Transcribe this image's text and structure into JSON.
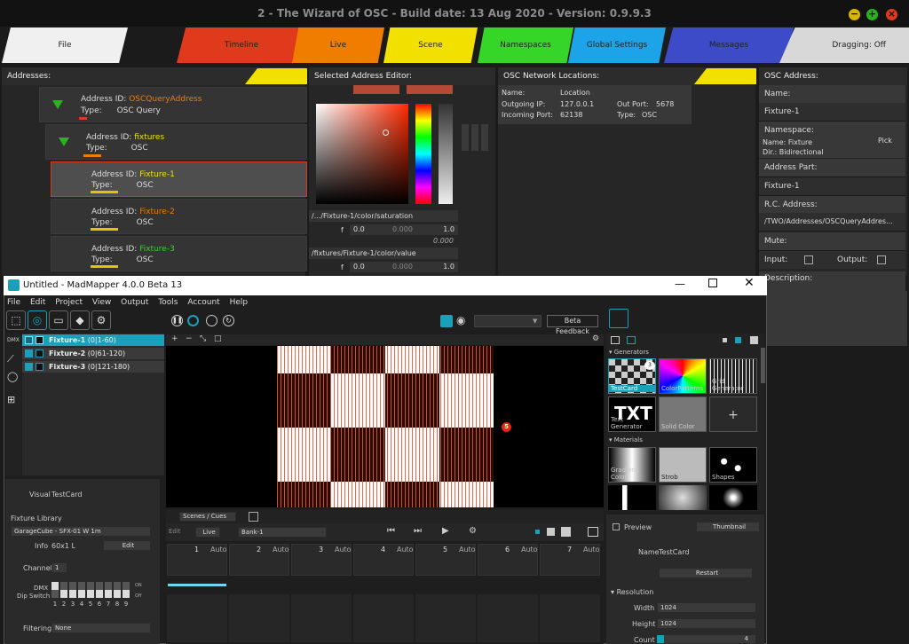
{
  "window_title": "2 - The Wizard of OSC - Build date: 13 Aug 2020 - Version: 0.9.9.3",
  "tabs": [
    {
      "label": "File",
      "color": "#f0f0f0"
    },
    {
      "label": "Timeline",
      "color": "#e03a1c"
    },
    {
      "label": "Live",
      "color": "#f07c00"
    },
    {
      "label": "Scene",
      "color": "#f2e100"
    },
    {
      "label": "Namespaces",
      "color": "#35d628"
    },
    {
      "label": "Global Settings",
      "color": "#1ca3e8"
    },
    {
      "label": "Messages",
      "color": "#3d4bc9"
    },
    {
      "label": "Dragging: Off",
      "color": "#d8d8d8"
    }
  ],
  "panels": {
    "addresses": "Addresses:",
    "selected_editor": "Selected Address Editor:",
    "osc_network": "OSC Network Locations:",
    "osc_address": "OSC Address:"
  },
  "addresses": [
    {
      "id_label": "Address ID:",
      "id": "OSCQueryAddress",
      "type_label": "Type:",
      "type": "OSC Query",
      "id_color": "#f07c00"
    },
    {
      "id_label": "Address ID:",
      "id": "fixtures",
      "type_label": "Type:",
      "type": "OSC",
      "id_color": "#f2e100"
    },
    {
      "id_label": "Address ID:",
      "id": "Fixture-1",
      "type_label": "Type:",
      "type": "OSC",
      "id_color": "#f2e100"
    },
    {
      "id_label": "Address ID:",
      "id": "Fixture-2",
      "type_label": "Type:",
      "type": "OSC",
      "id_color": "#f07c00"
    },
    {
      "id_label": "Address ID:",
      "id": "Fixture-3",
      "type_label": "Type:",
      "type": "OSC",
      "id_color": "#35d628"
    }
  ],
  "editor": {
    "sat_path": "/.../Fixture-1/color/saturation",
    "sat_f": "f",
    "sat_min": "0.0",
    "sat_mid": "0.000",
    "sat_max": "1.0",
    "sat_val": "0.000",
    "val_path": "/fixtures/Fixture-1/color/value",
    "val_f": "f",
    "val_min": "0.0",
    "val_mid": "0.000",
    "val_max": "1.0"
  },
  "network": {
    "name_label": "Name:",
    "name": "Location",
    "out_ip_label": "Outgoing IP:",
    "out_ip": "127.0.0.1",
    "out_port_label": "Out Port:",
    "out_port": "5678",
    "in_port_label": "Incoming Port:",
    "in_port": "62138",
    "type_label": "Type:",
    "type": "OSC"
  },
  "osc_address": {
    "name_label": "Name:",
    "name": "Fixture-1",
    "namespace_label": "Namespace:",
    "ns_name": "Name: Fixture",
    "ns_dir": "Dir.:    Bidirectional",
    "pick": "Pick",
    "address_part_label": "Address Part:",
    "address_part": "Fixture-1",
    "rc_label": "R.C. Address:",
    "rc": "/TWO/Addresses/OSCQueryAddres...",
    "mute_label": "Mute:",
    "input_label": "Input:",
    "output_label": "Output:",
    "description_label": "Description:"
  },
  "mm": {
    "title": "Untitled - MadMapper 4.0.0 Beta 13",
    "menu": [
      "File",
      "Edit",
      "Project",
      "View",
      "Output",
      "Tools",
      "Account",
      "Help"
    ],
    "beta_feedback": "Beta Feedback",
    "fixtures": [
      {
        "name": "Fixture-1",
        "range": "(0|1-60)"
      },
      {
        "name": "Fixture-2",
        "range": "(0|61-120)"
      },
      {
        "name": "Fixture-3",
        "range": "(0|121-180)"
      }
    ],
    "side_labels": {
      "dmx": "DMX"
    },
    "canvas_tools": [
      "+",
      "−",
      "⤡",
      "□"
    ],
    "lib_sections": {
      "generators": "Generators",
      "materials": "Materials"
    },
    "generators": [
      {
        "label": "TestCard"
      },
      {
        "label": "ColorPatterns"
      },
      {
        "label": "Grid Generator"
      },
      {
        "label": "Text Generator"
      },
      {
        "label": "Solid Color"
      },
      {
        "label": "+"
      }
    ],
    "thumb_badge": "3",
    "materials": [
      {
        "label": "Gradient Color"
      },
      {
        "label": "Strob"
      },
      {
        "label": "Shapes"
      }
    ],
    "txt_logo": "TXT",
    "visual_label": "Visual",
    "visual": "TestCard",
    "fixture_library": "Fixture Library",
    "fixture_model": "GarageCube - SFX-01 W 1m",
    "info_label": "Info",
    "info": "60x1 L",
    "edit": "Edit",
    "channel_label": "Channel",
    "channel": "1",
    "dmx_label": "DMX",
    "dip_label": "Dip Switch",
    "dip_on": "ON",
    "dip_off": "Off",
    "dip_nums": [
      "1",
      "2",
      "3",
      "4",
      "5",
      "6",
      "7",
      "8",
      "9"
    ],
    "filtering_label": "Filtering",
    "filtering": "None",
    "scenes_cues": "Scenes / Cues",
    "edit_btn": "Edit",
    "live_btn": "Live",
    "bank": "Bank-1",
    "cues": [
      {
        "n": "1",
        "mode": "Auto"
      },
      {
        "n": "2",
        "mode": "Auto"
      },
      {
        "n": "3",
        "mode": "Auto"
      },
      {
        "n": "4",
        "mode": "Auto"
      },
      {
        "n": "5",
        "mode": "Auto"
      },
      {
        "n": "6",
        "mode": "Auto"
      },
      {
        "n": "7",
        "mode": "Auto"
      }
    ],
    "preview": "Preview",
    "thumbnail": "Thumbnail",
    "name_label": "Name",
    "name": "TestCard",
    "restart": "Restart",
    "resolution": "Resolution",
    "width_label": "Width",
    "width": "1024",
    "height_label": "Height",
    "height": "1024",
    "count_label": "Count",
    "count": "4",
    "canvas_badge": "5"
  }
}
